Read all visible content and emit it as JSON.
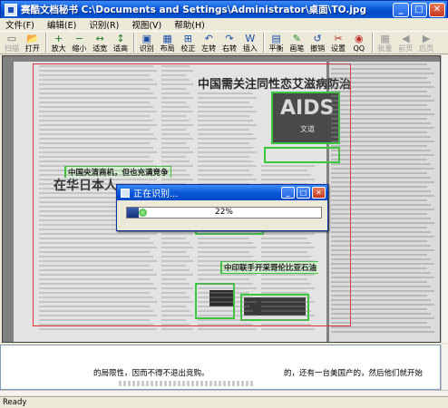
{
  "window": {
    "title": "赛酷文档秘书 C:\\Documents and Settings\\Administrator\\桌面\\TO.jpg",
    "minimize": "_",
    "maximize": "□",
    "close": "✕"
  },
  "menu": {
    "file": "文件(F)",
    "edit": "编辑(E)",
    "recognize": "识别(R)",
    "view": "视图(V)",
    "help": "帮助(H)"
  },
  "toolbar": [
    {
      "label": "扫描",
      "icon": "scanner-icon",
      "glyph": "▭",
      "enabled": false
    },
    {
      "label": "打开",
      "icon": "folder-open-icon",
      "glyph": "📂",
      "enabled": true
    },
    {
      "label": "放大",
      "icon": "zoom-in-icon",
      "glyph": "+",
      "enabled": true
    },
    {
      "label": "缩小",
      "icon": "zoom-out-icon",
      "glyph": "−",
      "enabled": true
    },
    {
      "label": "适宽",
      "icon": "fit-width-icon",
      "glyph": "↔",
      "enabled": true
    },
    {
      "label": "适高",
      "icon": "fit-height-icon",
      "glyph": "↕",
      "enabled": true
    },
    {
      "label": "识别",
      "icon": "recognize-icon",
      "glyph": "▣",
      "enabled": true
    },
    {
      "label": "布局",
      "icon": "layout-icon",
      "glyph": "▦",
      "enabled": true
    },
    {
      "label": "校正",
      "icon": "deskew-icon",
      "glyph": "⊞",
      "enabled": true
    },
    {
      "label": "左转",
      "icon": "rotate-left-icon",
      "glyph": "↶",
      "enabled": true
    },
    {
      "label": "右转",
      "icon": "rotate-right-icon",
      "glyph": "↷",
      "enabled": true
    },
    {
      "label": "插入",
      "icon": "insert-icon",
      "glyph": "W",
      "enabled": true
    },
    {
      "label": "平衡",
      "icon": "balance-icon",
      "glyph": "▤",
      "enabled": true
    },
    {
      "label": "画笔",
      "icon": "pen-icon",
      "glyph": "✎",
      "enabled": true
    },
    {
      "label": "撤销",
      "icon": "undo-icon",
      "glyph": "↺",
      "enabled": true
    },
    {
      "label": "设置",
      "icon": "settings-icon",
      "glyph": "✂",
      "enabled": true
    },
    {
      "label": "QQ",
      "icon": "qq-icon",
      "glyph": "◉",
      "enabled": true
    },
    {
      "label": "批量",
      "icon": "batch-icon",
      "glyph": "▦",
      "enabled": false
    },
    {
      "label": "前页",
      "icon": "prev-page-icon",
      "glyph": "◀",
      "enabled": false
    },
    {
      "label": "后页",
      "icon": "next-page-icon",
      "glyph": "▶",
      "enabled": false
    }
  ],
  "document": {
    "headline_main": "中国需关注同性恋艾滋病防治",
    "headline_left": "在华日本人",
    "aids_text": "AIDS",
    "aids_sub": "文道",
    "green_label_1": "中国央清商机，但也充满竞争",
    "green_label_2": "中印联手开采哥伦比亚石油"
  },
  "dialog": {
    "title": "正在识别...",
    "progress_text": "22%",
    "progress_fraction": 0.22
  },
  "textpane": {
    "line1_left": "的局限性，因而不得不退出竞购。",
    "line1_right": "的，还有一台美国产的，然后他们就开始"
  },
  "statusbar": {
    "text": "Ready"
  }
}
